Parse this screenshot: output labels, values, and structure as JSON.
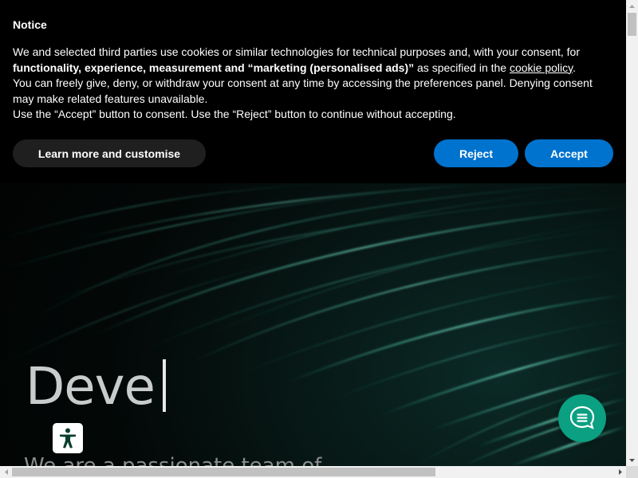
{
  "cookie_notice": {
    "title": "Notice",
    "text_intro": "We and selected third parties use cookies or similar technologies for technical purposes and, with your consent, for",
    "text_bold": "functionality, experience, measurement and “marketing (personalised ads)”",
    "text_specified": " as specified in the ",
    "policy_link": "cookie policy",
    "text_period": ".",
    "text_line2": "You can freely give, deny, or withdraw your consent at any time by accessing the preferences panel. Denying consent may make related features unavailable.",
    "text_line3": "Use the “Accept” button to consent. Use the “Reject” button to continue without accepting.",
    "learn_more_label": "Learn more and customise",
    "reject_label": "Reject",
    "accept_label": "Accept",
    "button_color": "#0073ce"
  },
  "hero": {
    "typed_title": "Deve",
    "subtitle": "We are a passionate team of",
    "accent_color": "#3fe0b8"
  },
  "widgets": {
    "accessibility_icon": "accessibility-person-icon",
    "chat_icon": "chat-bubble-icon",
    "chat_color": "#0aa081"
  }
}
